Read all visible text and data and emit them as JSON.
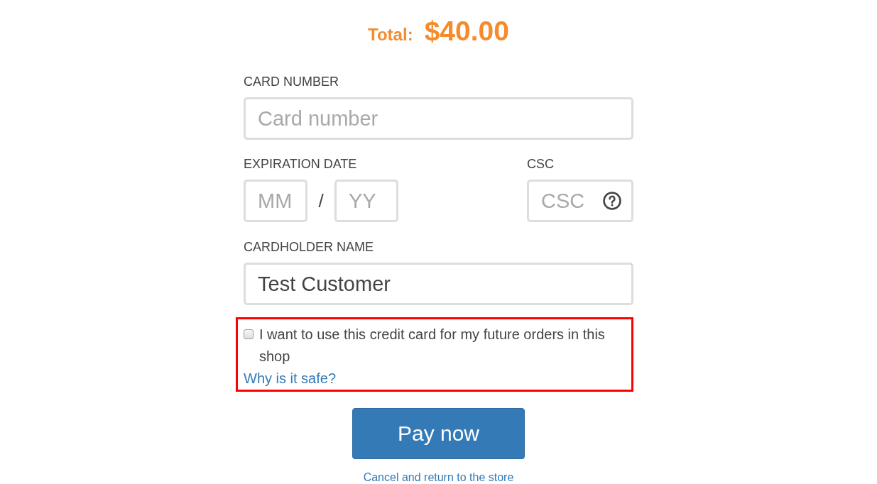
{
  "total": {
    "label": "Total:",
    "amount": "$40.00"
  },
  "form": {
    "card_number": {
      "label": "CARD NUMBER",
      "placeholder": "Card number"
    },
    "expiration_date": {
      "label": "EXPIRATION DATE",
      "month": {
        "placeholder": "MM"
      },
      "separator": "/",
      "year": {
        "placeholder": "YY"
      }
    },
    "csc": {
      "label": "CSC",
      "placeholder": "CSC"
    },
    "cardholder_name": {
      "label": "CARDHOLDER NAME",
      "value": "Test Customer"
    },
    "save_card": {
      "highlighted": true,
      "checked": false,
      "label": "I want to use this credit card for my future orders in this shop",
      "link": "Why is it safe?"
    }
  },
  "pay_button": "Pay now",
  "cancel_link": "Cancel and return to the store"
}
